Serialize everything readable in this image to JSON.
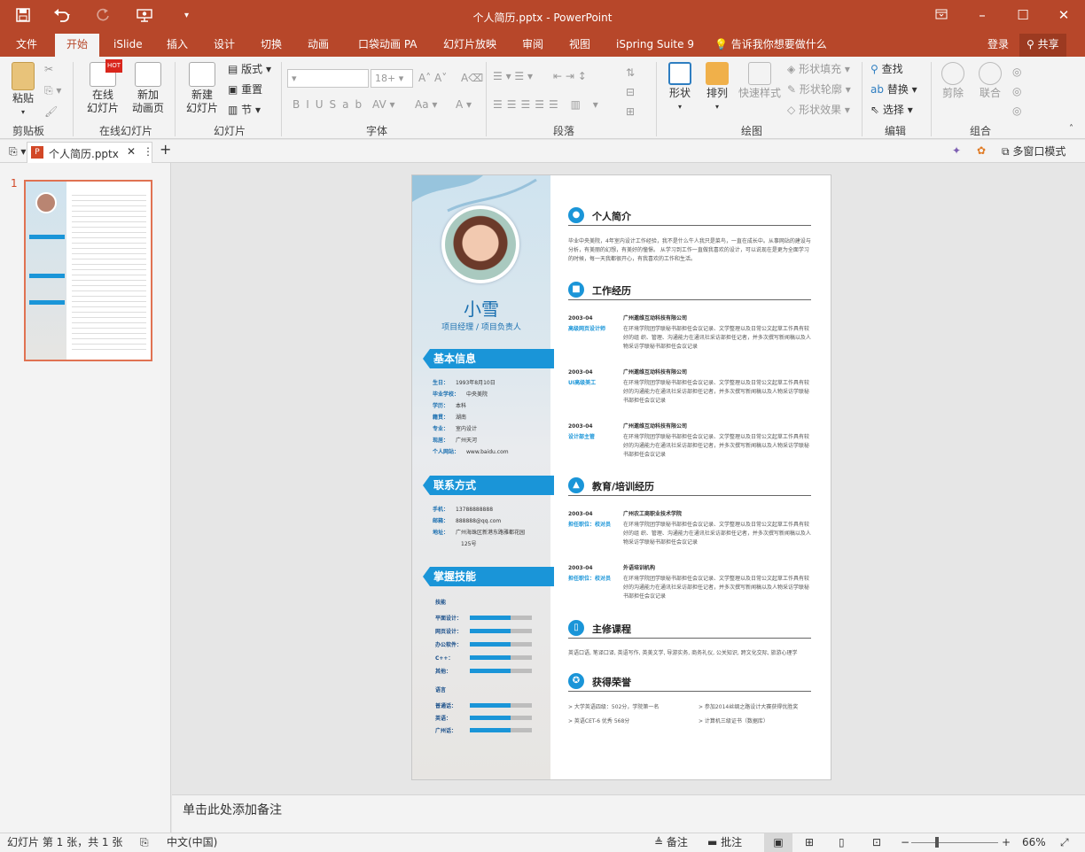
{
  "app": {
    "title": "个人简历.pptx - PowerPoint",
    "accent": "#b7472a",
    "quick_access": [
      "save-icon",
      "undo-icon",
      "redo-icon",
      "present-icon",
      "customize-icon"
    ]
  },
  "tabs": [
    "文件",
    "开始",
    "iSlide",
    "插入",
    "设计",
    "切换",
    "动画",
    "口袋动画 PA",
    "幻灯片放映",
    "审阅",
    "视图",
    "iSpring Suite 9"
  ],
  "tell_me": "告诉我你想要做什么",
  "login": "登录",
  "share": "共享",
  "ribbon": {
    "clipboard": {
      "paste": "粘贴",
      "label": "剪贴板"
    },
    "online": {
      "online_slide": "在线\n幻灯片",
      "new_anim": "新加\n动画页",
      "label": "在线幻灯片",
      "hot": "HOT"
    },
    "slides": {
      "new_slide": "新建\n幻灯片",
      "layout": "版式",
      "reset": "重置",
      "section": "节",
      "label": "幻灯片"
    },
    "font": {
      "font_size": "18+",
      "label": "字体"
    },
    "paragraph": {
      "label": "段落"
    },
    "drawing": {
      "shape": "形状",
      "arrange": "排列",
      "quick_style": "快速样式",
      "fill": "形状填充",
      "outline": "形状轮廓",
      "effect": "形状效果",
      "label": "绘图"
    },
    "editing": {
      "find": "查找",
      "replace": "替换",
      "select": "选择",
      "label": "编辑"
    },
    "combine": {
      "cut": "剪除",
      "union": "联合",
      "label": "组合"
    }
  },
  "doc_tab": "个人简历.pptx",
  "multi_window": "多窗口模式",
  "slide_number": "1",
  "notes_placeholder": "单击此处添加备注",
  "status": {
    "slide_info": "幻灯片 第 1 张，共 1 张",
    "language": "中文(中国)",
    "notes": "备注",
    "comments": "批注",
    "zoom": "66%"
  },
  "resume": {
    "name": "小雪",
    "role": "项目经理 / 项目负责人",
    "basic_title": "基本信息",
    "basic": [
      {
        "k": "生日：",
        "v": "1993年8月10日"
      },
      {
        "k": "毕业学校：",
        "v": "中央美院"
      },
      {
        "k": "学历：",
        "v": "本科"
      },
      {
        "k": "籍贯：",
        "v": "湖南"
      },
      {
        "k": "专业：",
        "v": "室内设计"
      },
      {
        "k": "现居：",
        "v": "广州天河"
      },
      {
        "k": "个人网站：",
        "v": "www.baidu.com"
      }
    ],
    "contact_title": "联系方式",
    "contact": [
      {
        "k": "手机：",
        "v": "13788888888"
      },
      {
        "k": "邮箱：",
        "v": "888888@qq.com"
      },
      {
        "k": "地址：",
        "v": "广州海珠区新港东路雅都花园"
      },
      {
        "k": "",
        "v": "125号"
      }
    ],
    "skills_title": "掌握技能",
    "skills_head": "技能",
    "skills": [
      {
        "k": "平面设计：",
        "level": 0.65
      },
      {
        "k": "网页设计：",
        "level": 0.65
      },
      {
        "k": "办公软件：",
        "level": 0.65
      },
      {
        "k": "C++：",
        "level": 0.65
      },
      {
        "k": "其他：",
        "level": 0.65
      }
    ],
    "lang_head": "语言",
    "langs": [
      {
        "k": "普通话：",
        "level": 0.65
      },
      {
        "k": "英语：",
        "level": 0.65
      },
      {
        "k": "广州话：",
        "level": 0.65
      }
    ],
    "intro_title": "个人简介",
    "intro_text": "毕业中央美院，4年室内设计工作经验，我不是什么牛人我只是菜鸟，一直在成长中。从事网站的建设与分析，有美丽的幻想，有美好的憧憬。 从学习到工作一直做我喜欢的设计，可以说现在是更为全面学习的时候，每一天我都很开心，有我喜欢的工作和生活。",
    "work_title": "工作经历",
    "work": [
      {
        "date": "2003-04",
        "role": "高级网页设计师",
        "company": "广州邀维互动科技有限公司",
        "text": "在环境学院团学联秘书部担任会议记录、文学整理以及日常公文起草工作具有较好的组 织、管理、沟通能力在通讯社采访部担任记者，并多次撰写新闻稿以及人物采访学联秘书部担任会议记录"
      },
      {
        "date": "2003-04",
        "role": "UI高级美工",
        "company": "广州邀维互动科技有限公司",
        "text": "在环境学院团学联秘书部担任会议记录、文学整理以及日常公文起草工作具有较好的沟通能力在通讯社采访部担任记者，并多次撰写新闻稿以及人物采访学联秘书部担任会议记录"
      },
      {
        "date": "2003-04",
        "role": "设计部主管",
        "company": "广州邀维互动科技有限公司",
        "text": "在环境学院团学联秘书部担任会议记录、文学整理以及日常公文起草工作具有较好的沟通能力在通讯社采访部担任记者，并多次撰写新闻稿以及人物采访学联秘书部担任会议记录"
      }
    ],
    "edu_title": "教育/培训经历",
    "edu": [
      {
        "date": "2003-04",
        "role": "担任职位：校对员",
        "company": "广州农工商职业技术学院",
        "text": "在环境学院团学联秘书部担任会议记录、文学整理以及日常公文起草工作具有较好的组 织、管理、沟通能力在通讯社采访部担任记者，并多次撰写新闻稿以及人物采访学联秘书部担任会议记录"
      },
      {
        "date": "2003-04",
        "role": "担任职位：校对员",
        "company": "外语培训机构",
        "text": "在环境学院团学联秘书部担任会议记录、文学整理以及日常公文起草工作具有较好的沟通能力在通讯社采访部担任记者，并多次撰写新闻稿以及人物采访学联秘书部担任会议记录"
      }
    ],
    "course_title": "主修课程",
    "course_text": "英语口语, 笔译口译, 英语写作, 英美文学, 导游实务, 商务礼仪, 公关知识, 跨文化交际, 旅游心理学",
    "honor_title": "获得荣誉",
    "honors": [
      "> 大学英语四级：502分，学院第一名",
      "> 参加2014丝绸之路设计大赛获得优胜奖",
      "> 英语CET-6  优秀 568分",
      "> 计算机三级证书（数据库）"
    ]
  }
}
